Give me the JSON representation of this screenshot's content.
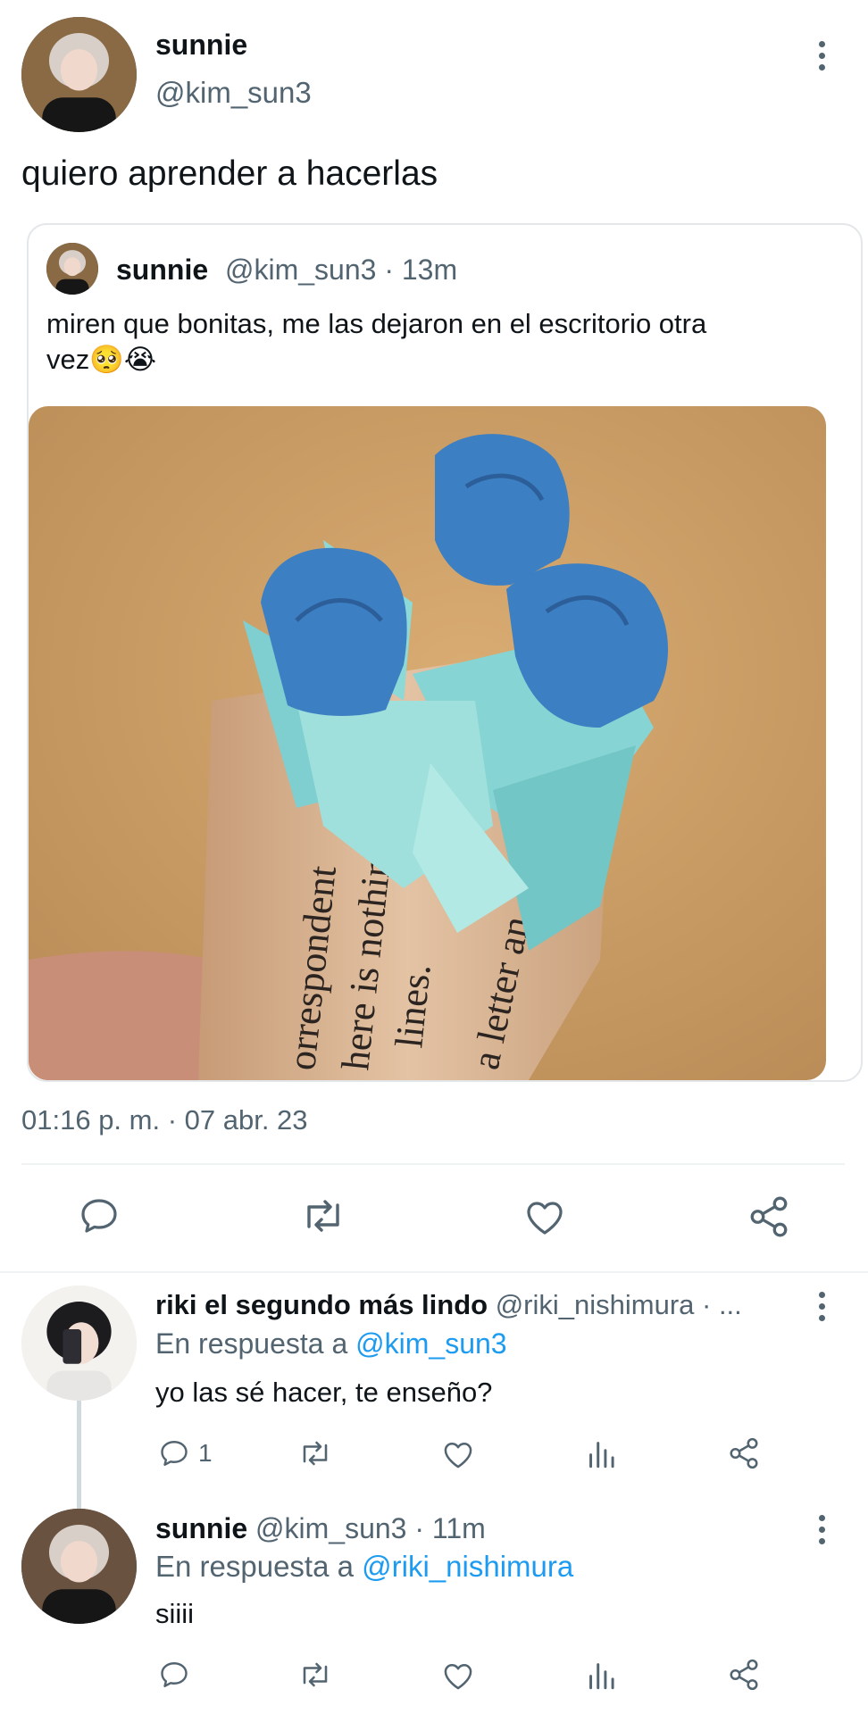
{
  "main_tweet": {
    "display_name": "sunnie",
    "handle": "@kim_sun3",
    "text": "quiero aprender a hacerlas",
    "timestamp": "01:16 p. m. · 07 abr. 23"
  },
  "quoted_tweet": {
    "display_name": "sunnie",
    "handle_time": "@kim_sun3 · 13m",
    "text_line1": "miren que bonitas, me las dejaron en el escritorio otra",
    "text_line2": "vez",
    "emoji": "🥺😭"
  },
  "reply_1": {
    "display_name": "riki el segundo más lindo",
    "handle_time": "@riki_nishimura · ...",
    "reply_prefix": "En respuesta a",
    "reply_to": "@kim_sun3",
    "text": "yo las sé hacer, te enseño?",
    "reply_count": "1"
  },
  "reply_2": {
    "display_name": "sunnie",
    "handle_time": "@kim_sun3 · 11m",
    "reply_prefix": "En respuesta a",
    "reply_to": "@riki_nishimura",
    "text": "siiii"
  },
  "colors": {
    "text": "#0f1419",
    "secondary": "#536471",
    "link": "#1d9bf0",
    "divider": "#eff3f4"
  },
  "icons": [
    "more-icon",
    "reply-icon",
    "retweet-icon",
    "like-icon",
    "share-icon",
    "views-icon"
  ]
}
